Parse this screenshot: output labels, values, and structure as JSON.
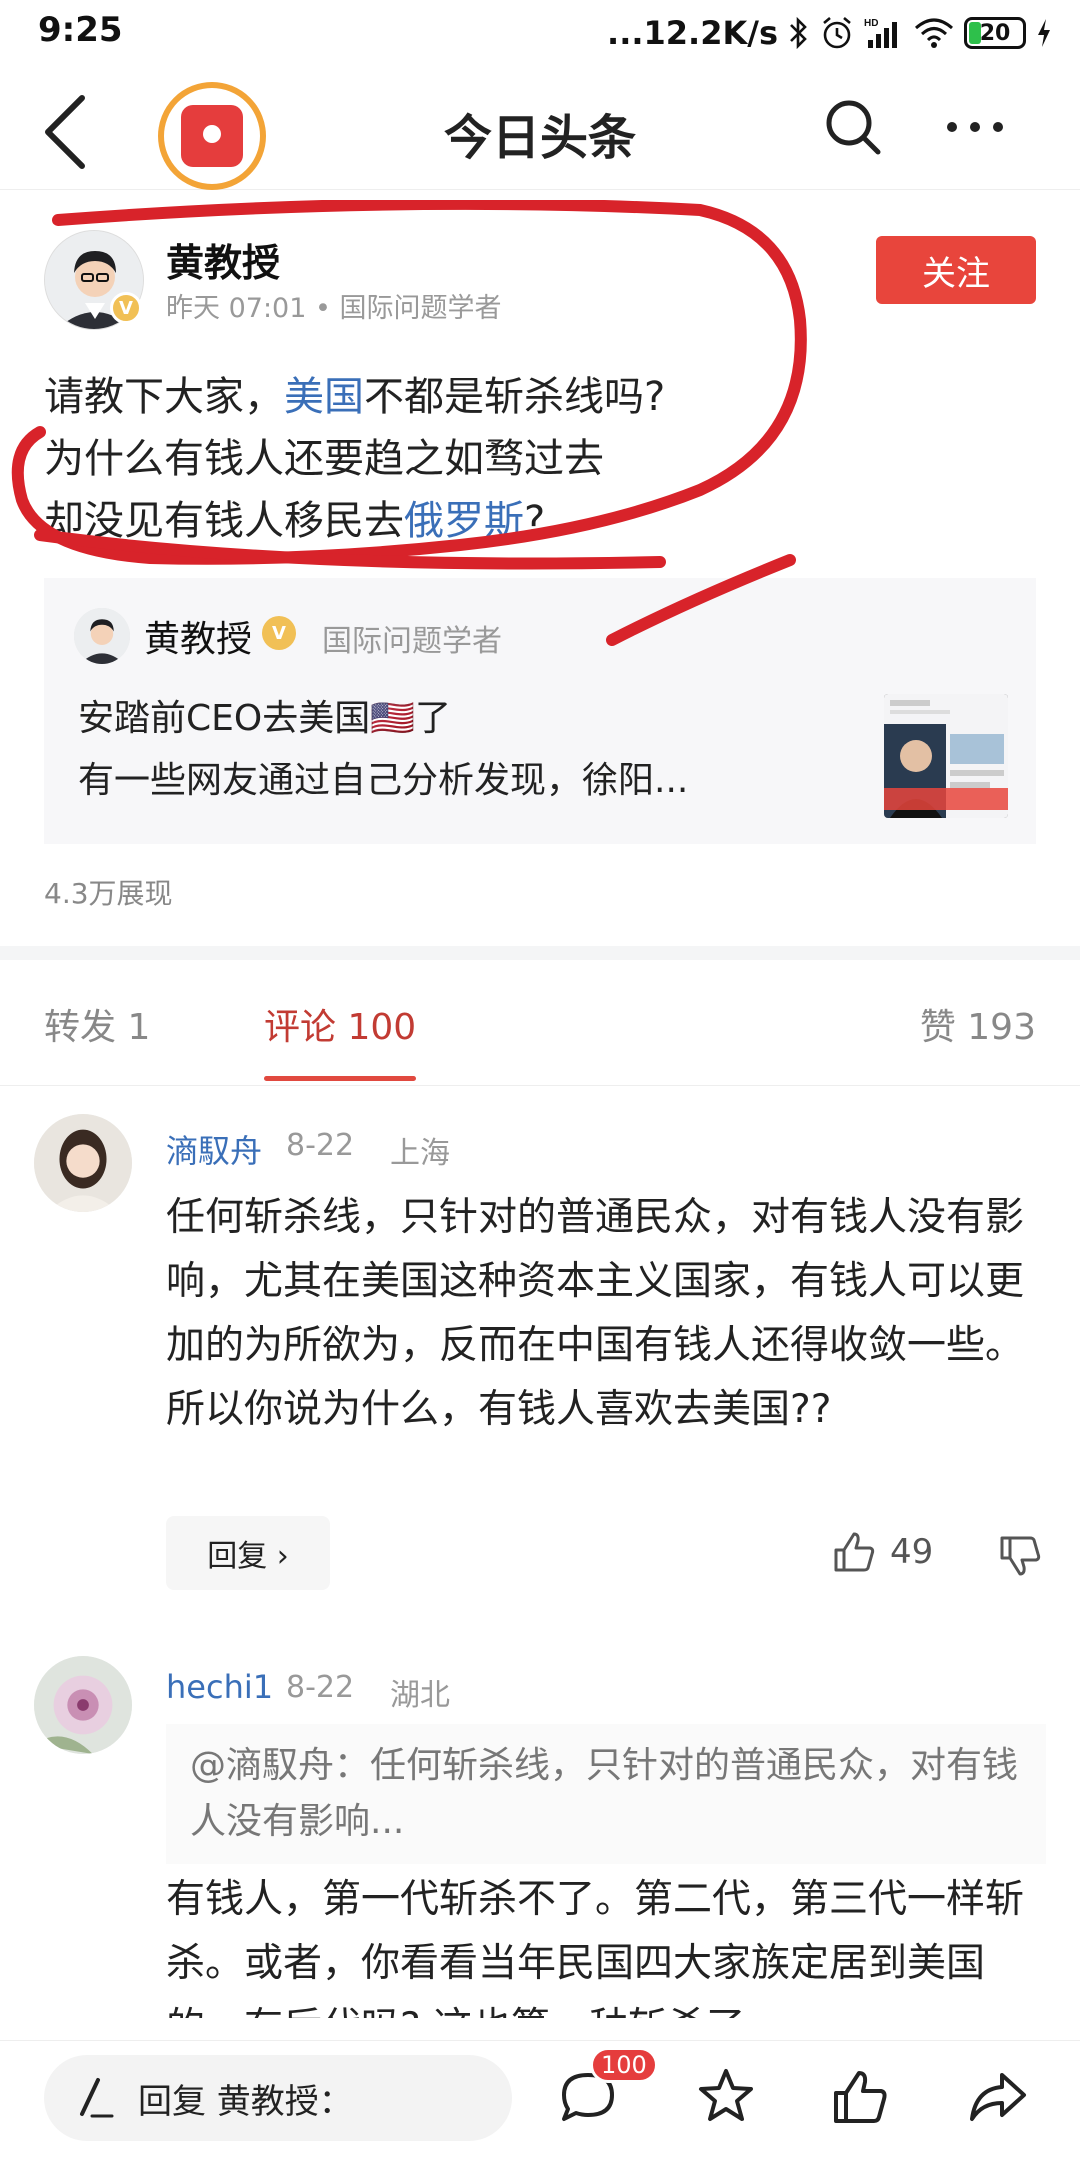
{
  "status_bar": {
    "time": "9:25",
    "network_speed": "...12.2K/s",
    "battery": "20"
  },
  "nav": {
    "title": "今日头条"
  },
  "post": {
    "author": "黄教授",
    "meta": "昨天  07:01 • 国际问题学者",
    "follow_label": "关注",
    "body": [
      [
        {
          "t": "请教下大家，"
        },
        {
          "t": "美国",
          "link": true
        },
        {
          "t": "不都是斩杀线吗?"
        }
      ],
      [
        {
          "t": "为什么有钱人还要趋之如骛过去"
        }
      ],
      [
        {
          "t": "却没见有钱人移民去"
        },
        {
          "t": "俄罗斯",
          "link": true
        },
        {
          "t": "?"
        }
      ]
    ],
    "quote": {
      "author": "黄教授",
      "badge": "V",
      "role": "国际问题学者",
      "line1": "安踏前CEO去美国🇺🇸了",
      "line2": "有一些网友通过自己分析发现，徐阳..."
    },
    "views": "4.3万展现"
  },
  "tabs": {
    "repost": "转发 1",
    "comments": "评论 100",
    "likes": "赞 193"
  },
  "comments": [
    {
      "name": "滳馭舟",
      "date": "8-22",
      "location": "上海",
      "text": "任何斩杀线，只针对的普通民众，对有钱人没有影响，尤其在美国这种资本主义国家，有钱人可以更加的为所欲为，反而在中国有钱人还得收敛一些。所以你说为什么，有钱人喜欢去美国??",
      "reply_label": "回复 ›",
      "likes": "49"
    },
    {
      "name": "hechi1",
      "date": "8-22",
      "location": "湖北",
      "quote": "@滳馭舟：任何斩杀线，只针对的普通民众，对有钱人没有影响...",
      "text": "有钱人，第一代斩杀不了。第二代，第三代一样斩杀。或者，你看看当年民国四大家族定居到美国的，有后代吗? 这也算一种斩杀了。"
    }
  ],
  "bottom_bar": {
    "reply_placeholder": "回复 黄教授：",
    "comment_badge": "100"
  },
  "colors": {
    "accent_red": "#e8453c",
    "link_blue": "#3a6fb8",
    "marker_red": "#d8232a"
  }
}
